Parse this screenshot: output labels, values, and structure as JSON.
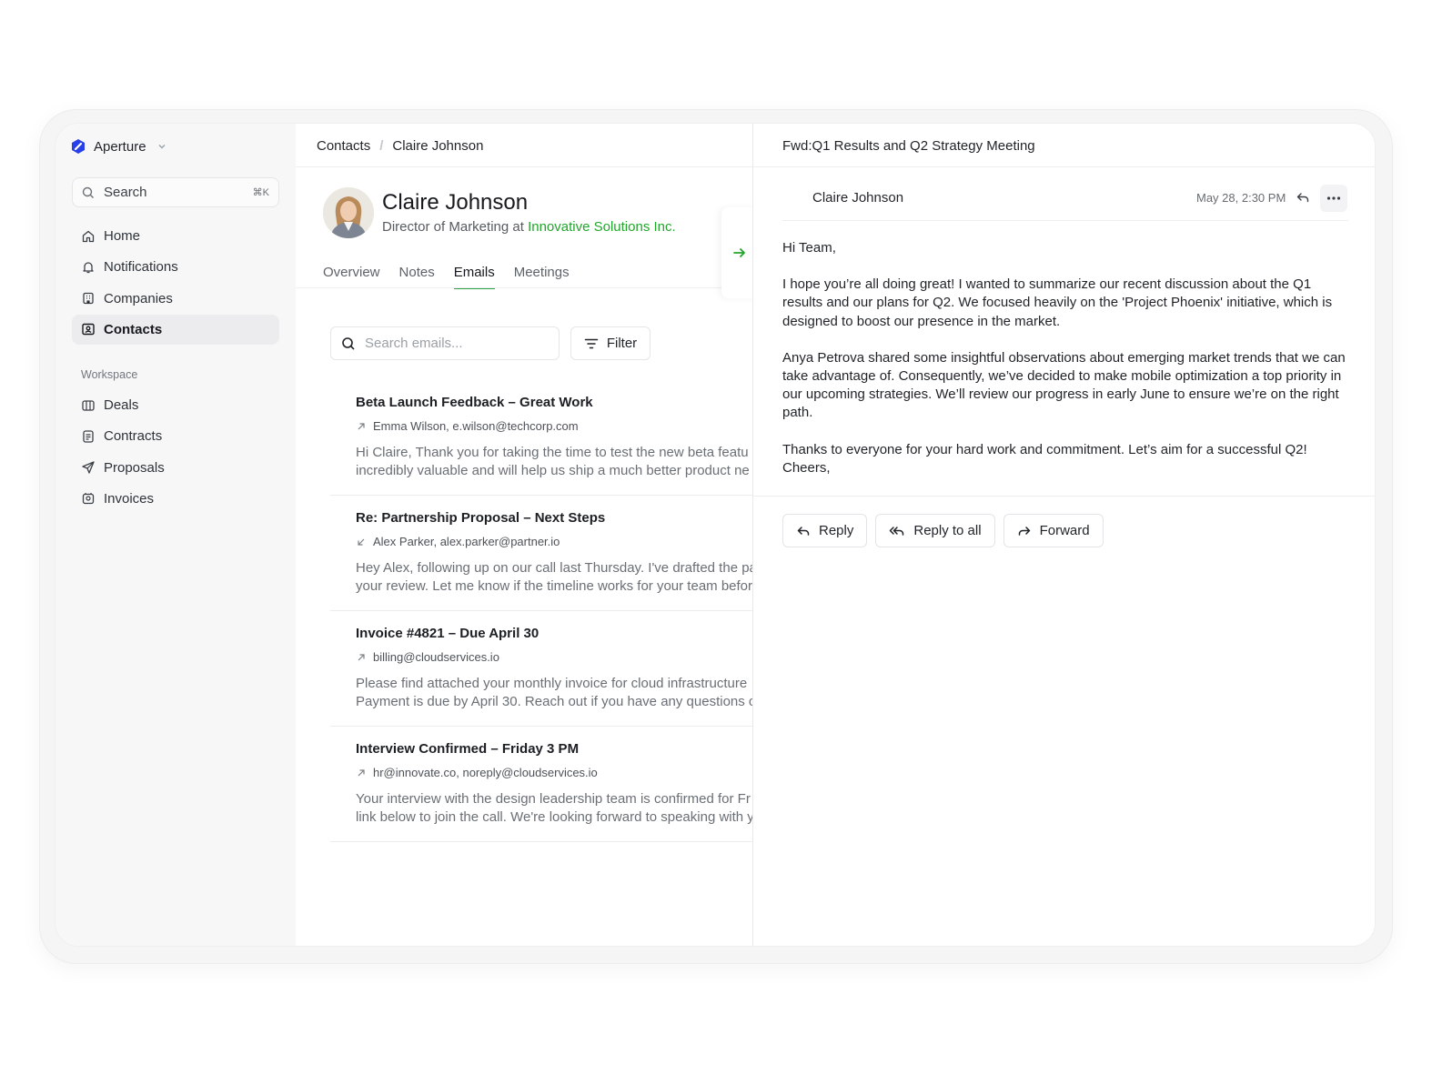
{
  "app": {
    "name": "Aperture",
    "search_label": "Search",
    "search_shortcut": "⌘K"
  },
  "sidebar": {
    "items": [
      {
        "label": "Home",
        "icon": "home-icon"
      },
      {
        "label": "Notifications",
        "icon": "bell-icon"
      },
      {
        "label": "Companies",
        "icon": "building-icon"
      },
      {
        "label": "Contacts",
        "icon": "contact-card-icon",
        "active": true
      }
    ],
    "workspace_label": "Workspace",
    "workspace_items": [
      {
        "label": "Deals",
        "icon": "deals-icon"
      },
      {
        "label": "Contracts",
        "icon": "document-icon"
      },
      {
        "label": "Proposals",
        "icon": "send-icon"
      },
      {
        "label": "Invoices",
        "icon": "invoice-icon"
      }
    ]
  },
  "breadcrumb": {
    "root": "Contacts",
    "current": "Claire Johnson"
  },
  "contact": {
    "name": "Claire Johnson",
    "title_prefix": "Director of Marketing at",
    "company": "Innovative Solutions Inc."
  },
  "tabs": [
    "Overview",
    "Notes",
    "Emails",
    "Meetings"
  ],
  "active_tab": "Emails",
  "email_search": {
    "placeholder": "Search emails..."
  },
  "filter_label": "Filter",
  "emails": [
    {
      "subject": "Beta Launch Feedback – Great Work",
      "direction": "outgoing",
      "meta": "Emma Wilson, e.wilson@techcorp.com",
      "line1": "Hi Claire, Thank you for taking the time to test the new beta featu",
      "line2": "incredibly valuable and will help us ship a much better product ne"
    },
    {
      "subject": "Re: Partnership Proposal – Next Steps",
      "direction": "incoming",
      "meta": "Alex Parker, alex.parker@partner.io",
      "line1": "Hey Alex, following up on our call last Thursday. I've drafted the pa",
      "line2": "your review. Let me know if the timeline works for your team befor"
    },
    {
      "subject": "Invoice #4821 – Due April 30",
      "direction": "outgoing",
      "meta": "billing@cloudservices.io",
      "line1": "Please find attached your monthly invoice for cloud infrastructure",
      "line2": "Payment is due by April 30. Reach out if you have any questions o"
    },
    {
      "subject": "Interview Confirmed – Friday 3 PM",
      "direction": "outgoing",
      "meta": "hr@innovate.co, noreply@cloudservices.io",
      "line1": "Your interview with the design leadership team is confirmed for Fr",
      "line2": "link below to join the call. We're looking forward to speaking with y"
    }
  ],
  "detail": {
    "subject": "Fwd:Q1 Results and Q2 Strategy Meeting",
    "sender": "Claire Johnson",
    "date": "May 28, 2:30 PM",
    "greeting": "Hi Team,",
    "paragraph1": "I hope you’re all doing great! I wanted to summarize our recent discussion about the Q1 results and our plans for Q2. We focused heavily on the 'Project Phoenix' initiative, which is designed to boost our presence in the market.",
    "paragraph2": "Anya Petrova shared some insightful observations about emerging market trends that we can take advantage of. Consequently, we’ve decided to make mobile optimization a top priority in our upcoming strategies. We’ll review our progress in early June to ensure we’re on the right path.",
    "paragraph3": "Thanks to everyone for your hard work and commitment. Let’s aim for a successful Q2!",
    "signoff": "Cheers,",
    "actions": {
      "reply": "Reply",
      "reply_all": "Reply to all",
      "forward": "Forward"
    }
  },
  "colors": {
    "accent_green": "#22a52b",
    "brand_blue": "#2740e8"
  }
}
